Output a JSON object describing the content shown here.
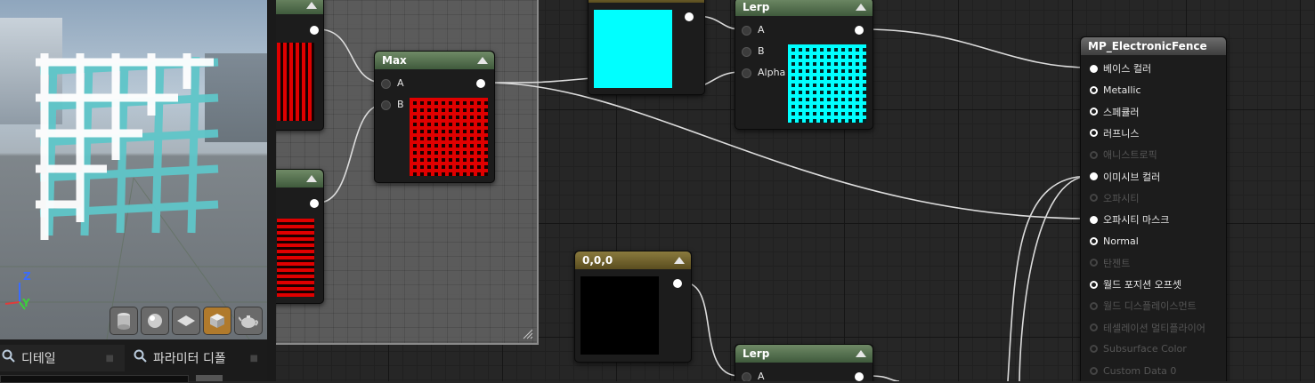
{
  "viewport": {
    "axis_labels": {
      "z": "Z",
      "y": "Y"
    },
    "toolbar_icons": [
      "cylinder-preview-icon",
      "sphere-preview-icon",
      "plane-preview-icon",
      "cube-preview-icon",
      "teapot-preview-icon"
    ]
  },
  "tabs": [
    {
      "label": "디테일",
      "icon": "search-icon"
    },
    {
      "label": "파라미터 디폴",
      "icon": "search-icon"
    }
  ],
  "nodes": {
    "max": {
      "title": "Max",
      "pins": [
        "A",
        "B"
      ]
    },
    "lerp_top": {
      "title": "Lerp",
      "pins": [
        "A",
        "B",
        "Alpha"
      ]
    },
    "constant3": {
      "title": "0,0,0"
    },
    "lerp_bottom": {
      "title": "Lerp",
      "pins": [
        "A"
      ]
    }
  },
  "material": {
    "title": "MP_ElectronicFence",
    "inputs": [
      {
        "label": "베이스 컬러",
        "enabled": true,
        "connected": true
      },
      {
        "label": "Metallic",
        "enabled": true,
        "connected": false
      },
      {
        "label": "스페큘러",
        "enabled": true,
        "connected": false
      },
      {
        "label": "러프니스",
        "enabled": true,
        "connected": false
      },
      {
        "label": "애니스트로픽",
        "enabled": false,
        "connected": false
      },
      {
        "label": "이미시브 컬러",
        "enabled": true,
        "connected": true
      },
      {
        "label": "오파시티",
        "enabled": false,
        "connected": false
      },
      {
        "label": "오파시티 마스크",
        "enabled": true,
        "connected": true
      },
      {
        "label": "Normal",
        "enabled": true,
        "connected": false
      },
      {
        "label": "탄젠트",
        "enabled": false,
        "connected": false
      },
      {
        "label": "월드 포지션 오프셋",
        "enabled": true,
        "connected": false
      },
      {
        "label": "월드 디스플레이스먼트",
        "enabled": false,
        "connected": false
      },
      {
        "label": "테셀레이션 멀티플라이어",
        "enabled": false,
        "connected": false
      },
      {
        "label": "Subsurface Color",
        "enabled": false,
        "connected": false
      },
      {
        "label": "Custom Data 0",
        "enabled": false,
        "connected": false
      }
    ]
  },
  "colors": {
    "cyan_preview": "#00ffff",
    "red_preview": "#e00000",
    "black_preview": "#000000",
    "header_green": "#4f6a4a",
    "header_gold": "#6e6030"
  }
}
